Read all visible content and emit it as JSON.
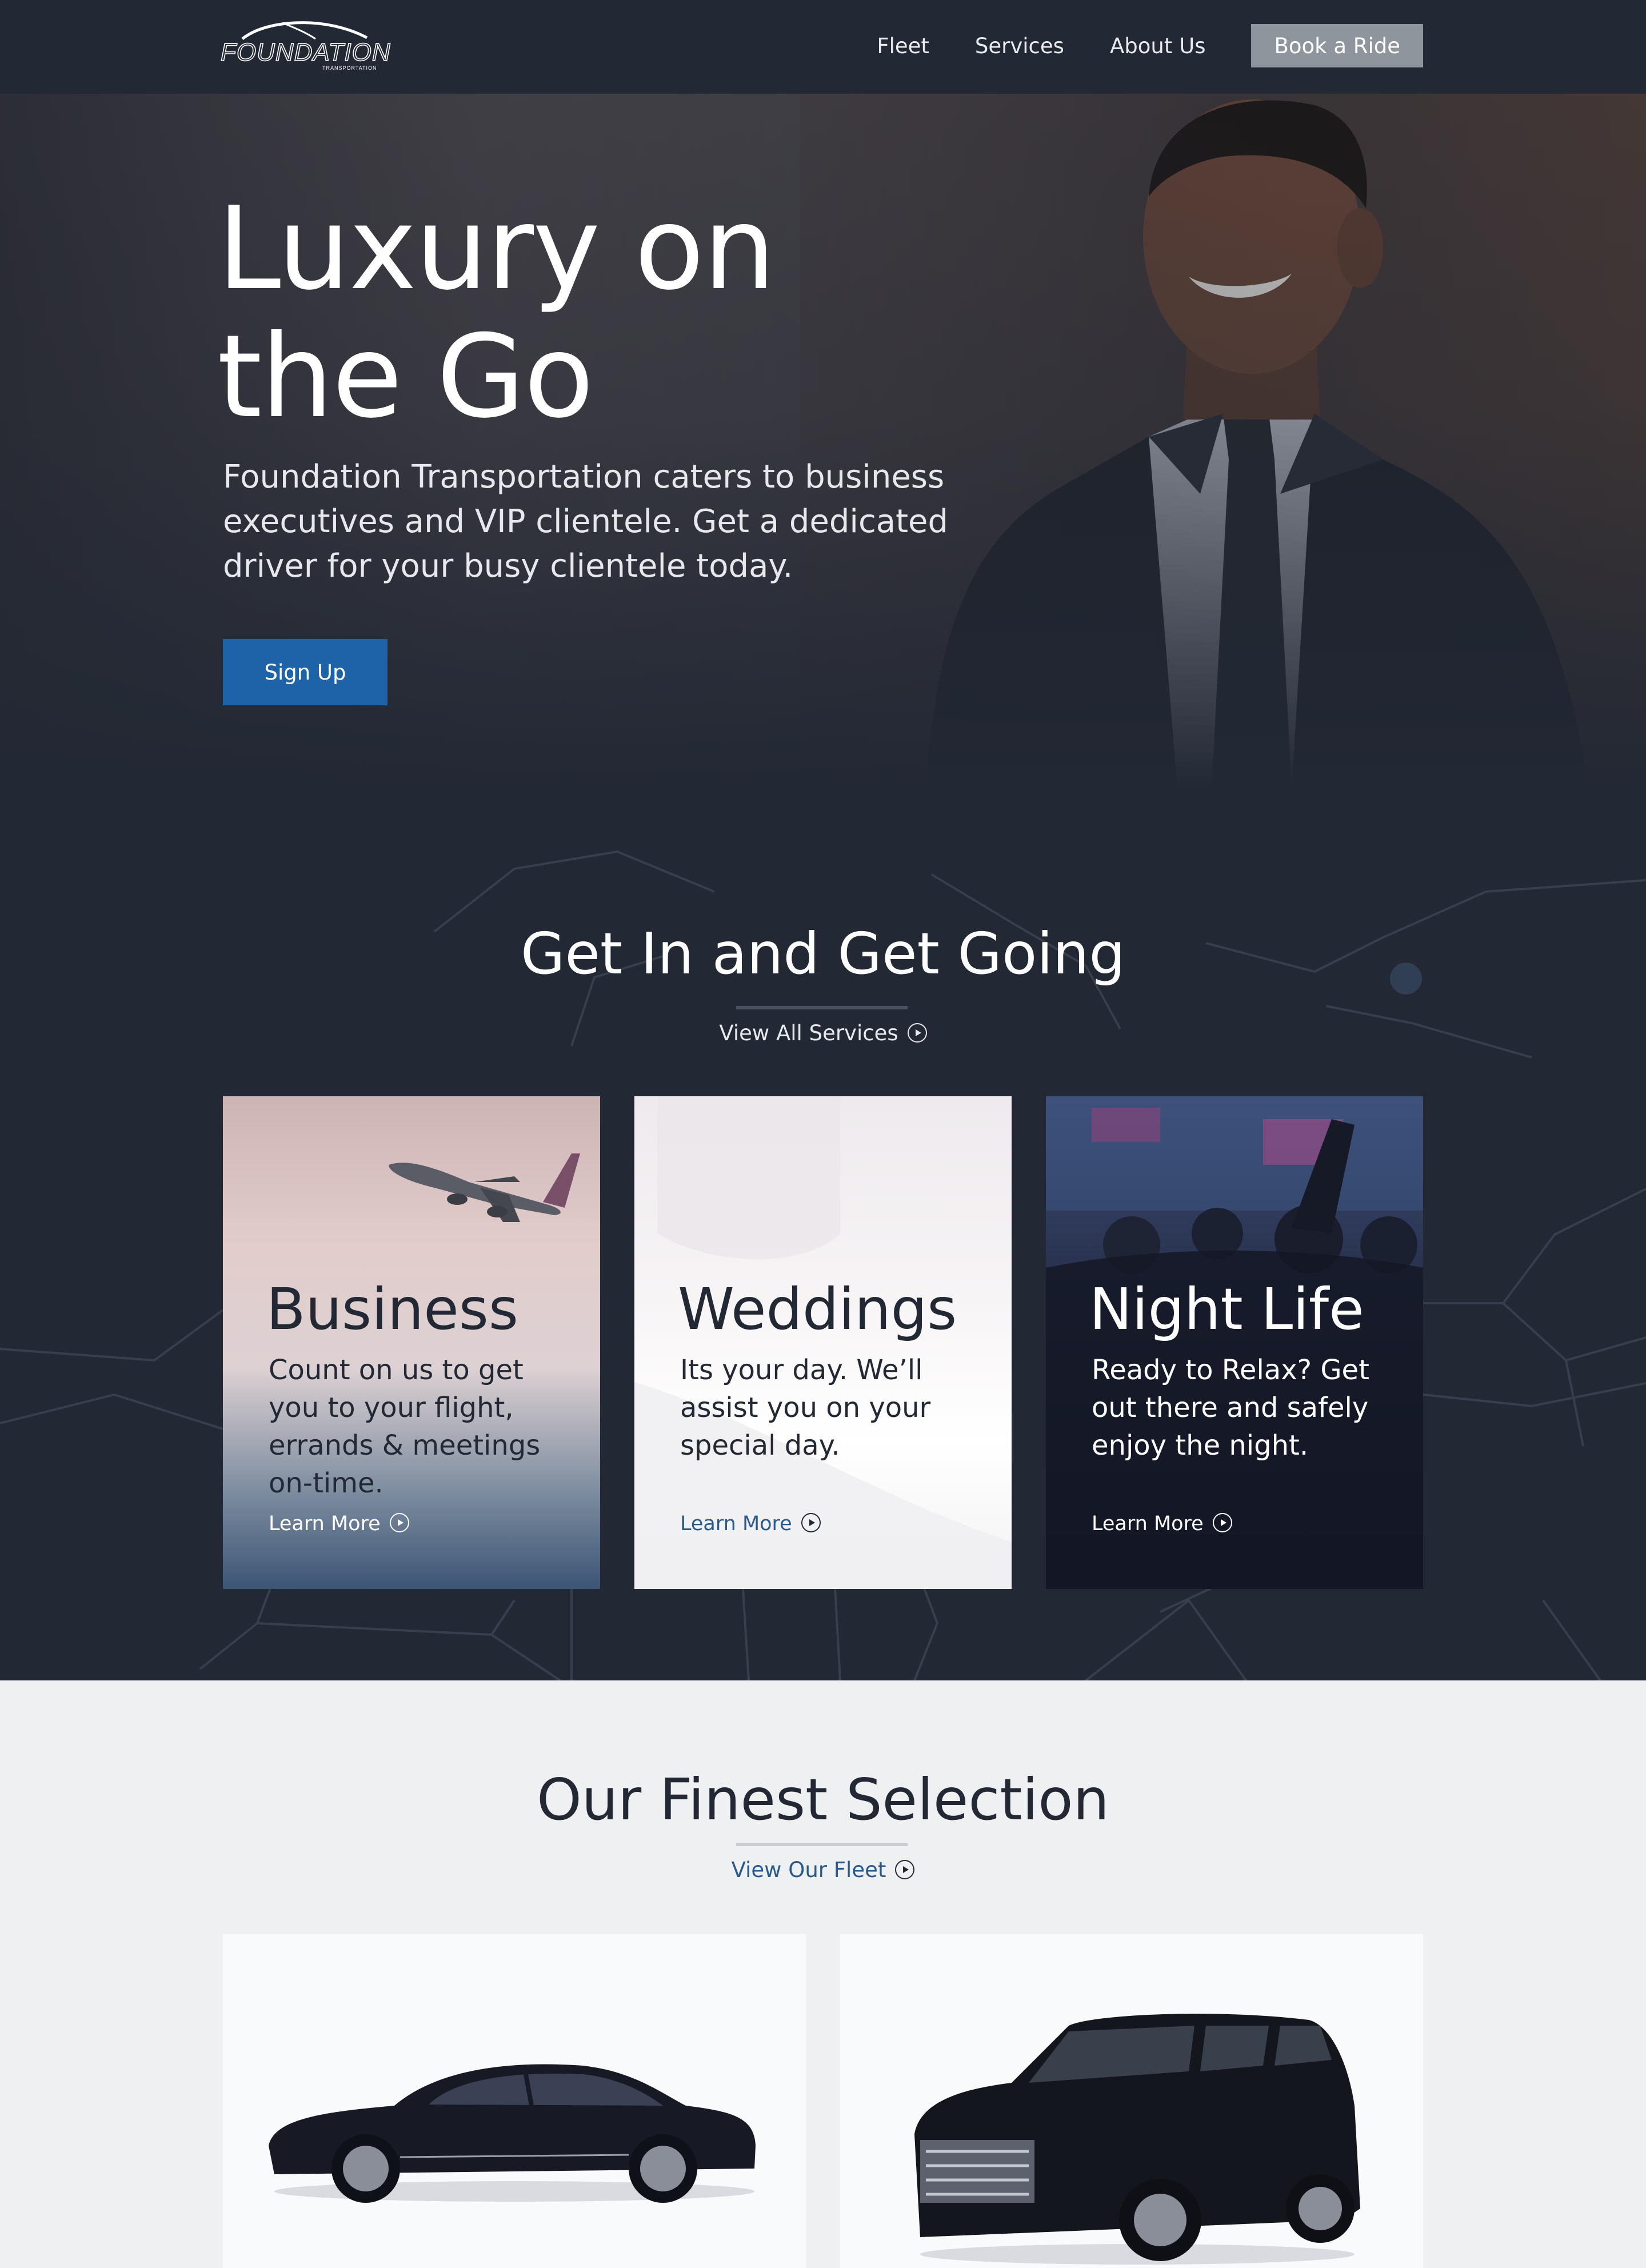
{
  "brand": {
    "name": "FOUNDATION",
    "tagline": "TRANSPORTATION"
  },
  "nav": {
    "links": [
      "Fleet",
      "Services",
      "About Us"
    ],
    "cta": "Book a Ride"
  },
  "hero": {
    "title_line1": "Luxury on",
    "title_line2": "the Go",
    "subtitle": "Foundation Transportation caters to business executives and VIP clientele. Get a dedicated driver for your busy clientele today.",
    "button": "Sign Up"
  },
  "services": {
    "title": "Get In and Get Going",
    "link": "View All Services",
    "cards": [
      {
        "title": "Business",
        "text": "Count on us to get you to your flight, errands & meetings on-time.",
        "link": "Learn More"
      },
      {
        "title": "Weddings",
        "text": "Its your day. We’ll assist you on your special day.",
        "link": "Learn More"
      },
      {
        "title": "Night Life",
        "text": "Ready to Relax? Get out there and safely enjoy the night.",
        "link": "Learn More"
      }
    ]
  },
  "fleet": {
    "title": "Our Finest Selection",
    "link": "View Our Fleet"
  },
  "colors": {
    "dark": "#222834",
    "accent_blue": "#1e62a8",
    "link_blue": "#2a5a8c",
    "nav_cta": "#8e959d",
    "light_bg": "#eff0f1"
  }
}
